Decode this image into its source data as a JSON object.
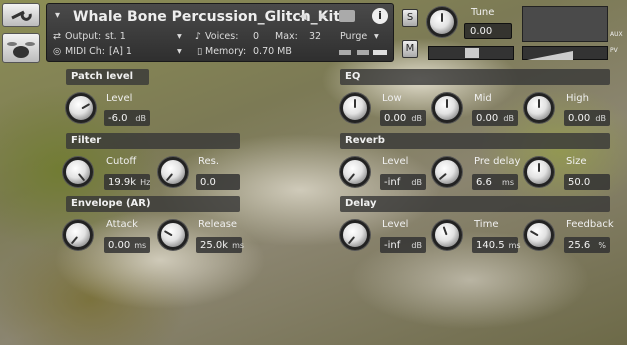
{
  "header": {
    "instrument_name": "Whale Bone Percussion_Glitch_Kit",
    "output_label": "Output:",
    "output_value": "st. 1",
    "voices_label": "Voices:",
    "voices_value": "0",
    "max_label": "Max:",
    "max_value": "32",
    "midi_label": "MIDI Ch:",
    "midi_value": "[A] 1",
    "memory_label": "Memory:",
    "memory_value": "0.70 MB",
    "purge_label": "Purge",
    "tune_label": "Tune",
    "tune_value": "0.00",
    "solo_label": "S",
    "mute_label": "M",
    "aux_label": "AUX",
    "pv_label": "PV"
  },
  "patch_level": {
    "title": "Patch level",
    "level_label": "Level",
    "level_value": "-6.0",
    "level_unit": "dB"
  },
  "eq": {
    "title": "EQ",
    "low_label": "Low",
    "low_value": "0.00",
    "low_unit": "dB",
    "mid_label": "Mid",
    "mid_value": "0.00",
    "mid_unit": "dB",
    "high_label": "High",
    "high_value": "0.00",
    "high_unit": "dB"
  },
  "filter": {
    "title": "Filter",
    "cutoff_label": "Cutoff",
    "cutoff_value": "19.9k",
    "cutoff_unit": "Hz",
    "res_label": "Res.",
    "res_value": "0.0"
  },
  "reverb": {
    "title": "Reverb",
    "level_label": "Level",
    "level_value": "-inf",
    "level_unit": "dB",
    "predelay_label": "Pre delay",
    "predelay_value": "6.6",
    "predelay_unit": "ms",
    "size_label": "Size",
    "size_value": "50.0"
  },
  "envelope": {
    "title": "Envelope (AR)",
    "attack_label": "Attack",
    "attack_value": "0.00",
    "attack_unit": "ms",
    "release_label": "Release",
    "release_value": "25.0k",
    "release_unit": "ms"
  },
  "delay": {
    "title": "Delay",
    "level_label": "Level",
    "level_value": "-inf",
    "level_unit": "dB",
    "time_label": "Time",
    "time_value": "140.5",
    "time_unit": "ms",
    "feedback_label": "Feedback",
    "feedback_value": "25.6",
    "feedback_unit": "%"
  }
}
